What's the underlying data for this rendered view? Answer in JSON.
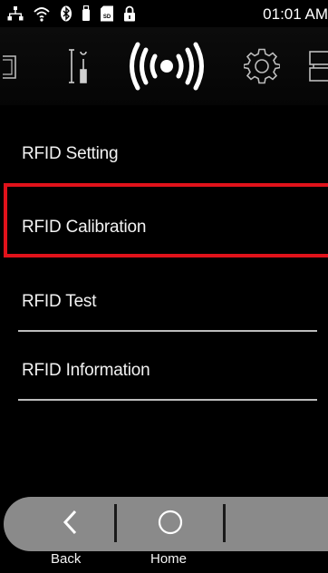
{
  "status_bar": {
    "time": "01:01 AM",
    "icons": [
      "ethernet-icon",
      "wifi-icon",
      "bluetooth-icon",
      "usb-icon",
      "sd-card-icon",
      "lock-icon"
    ]
  },
  "toolbar": {
    "items": [
      {
        "icon": "tab-left-partial-icon",
        "active": false
      },
      {
        "icon": "tools-icon",
        "active": false
      },
      {
        "icon": "rfid-signal-icon",
        "active": true
      },
      {
        "icon": "gear-icon",
        "active": false
      },
      {
        "icon": "tab-right-partial-icon",
        "active": false
      }
    ]
  },
  "menu": {
    "items": [
      {
        "label": "RFID Setting"
      },
      {
        "label": "RFID Calibration",
        "highlighted": true
      },
      {
        "label": "RFID Test"
      },
      {
        "label": "RFID Information"
      }
    ]
  },
  "nav": {
    "back_label": "Back",
    "home_label": "Home"
  },
  "colors": {
    "background": "#000000",
    "highlight": "#e0121a",
    "nav_bar": "#8a8a8a"
  }
}
